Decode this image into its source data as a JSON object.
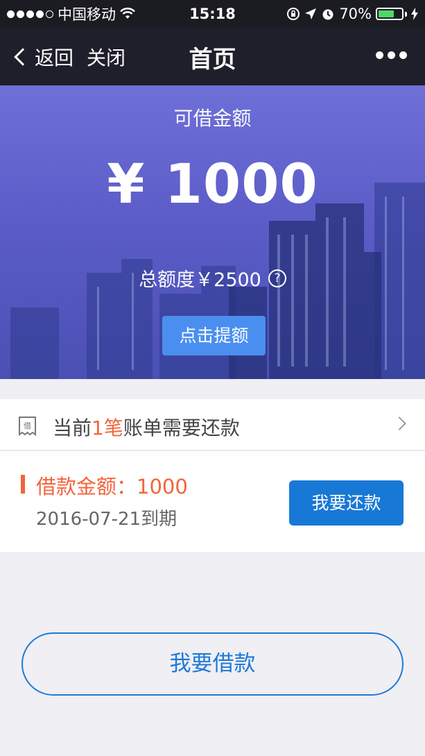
{
  "status_bar": {
    "carrier": "中国移动",
    "time": "15:18",
    "battery_percent": "70%",
    "battery_level": 0.7,
    "icons": [
      "signal-dots-icon",
      "wifi-icon",
      "rotation-lock-icon",
      "location-arrow-icon",
      "alarm-icon",
      "battery-icon",
      "charging-icon"
    ]
  },
  "nav": {
    "back_label": "返回",
    "close_label": "关闭",
    "title": "首页"
  },
  "hero": {
    "label": "可借金额",
    "amount": "¥ 1000",
    "total": "总额度￥2500",
    "help_symbol": "?",
    "raise_button": "点击提额"
  },
  "bill": {
    "prefix": "当前",
    "count": "1笔",
    "suffix": "账单需要还款",
    "icon_char": "借"
  },
  "loan": {
    "amount_text": "借款金额：1000",
    "due_text": "2016-07-21到期",
    "repay_button": "我要还款"
  },
  "borrow_button": "我要借款",
  "colors": {
    "accent_orange": "#f2643a",
    "primary_blue": "#1878d6",
    "hero_button": "#4a8ff0",
    "nav_bg": "#1f1f2b"
  }
}
